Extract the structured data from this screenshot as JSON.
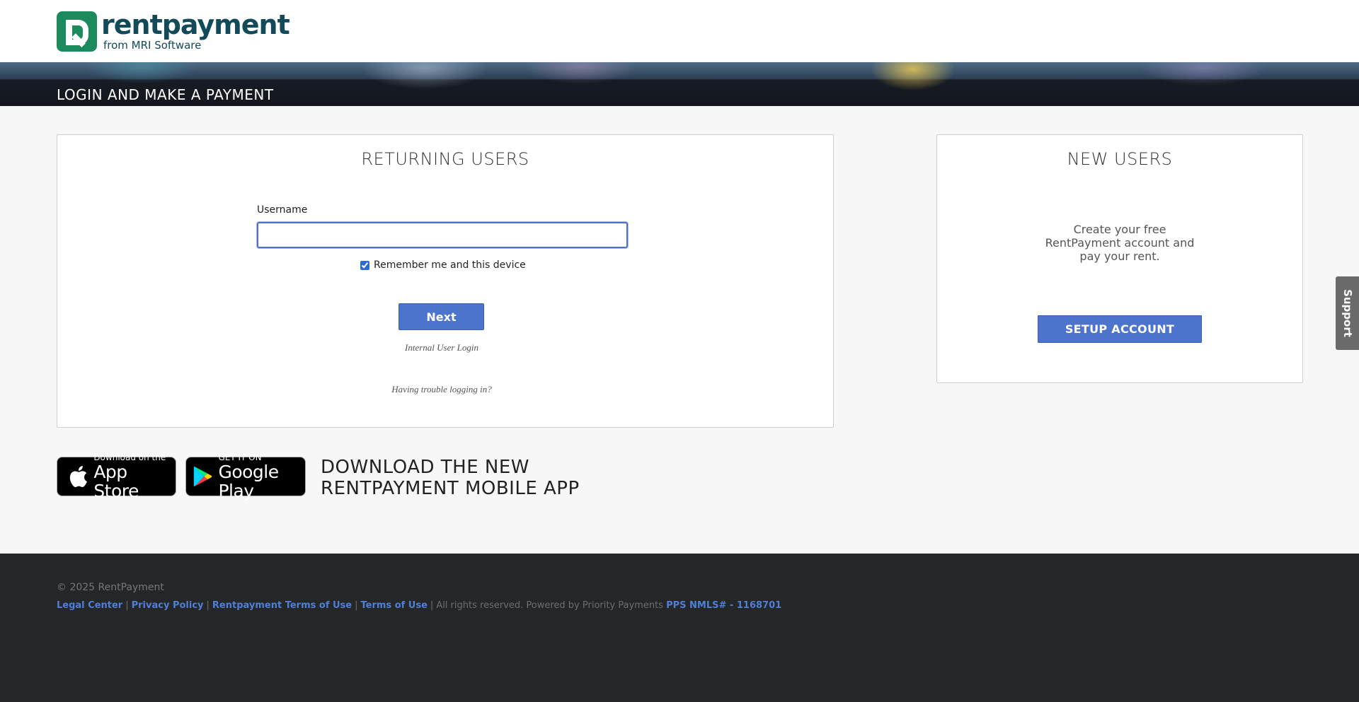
{
  "brand": {
    "name": "rentpayment",
    "subtitle": "from MRI Software",
    "color": "#1c8a5c",
    "text_color": "#134a5a"
  },
  "banner": {
    "title": "LOGIN AND MAKE A PAYMENT"
  },
  "returning": {
    "title": "RETURNING USERS",
    "username_label": "Username",
    "username_value": "",
    "remember_label": "Remember me and this device",
    "remember_checked": true,
    "next_label": "Next",
    "internal_login": "Internal User Login",
    "trouble": "Having trouble logging in?"
  },
  "new_users": {
    "title": "NEW USERS",
    "desc_line1": "Create your free",
    "desc_line2": "RentPayment account and",
    "desc_line3": "pay your rent.",
    "setup_label": "SETUP ACCOUNT"
  },
  "apps": {
    "apple_small": "Download on the",
    "apple_big": "App Store",
    "google_small": "GET IT ON",
    "google_big": "Google Play",
    "headline_line1": "DOWNLOAD THE NEW",
    "headline_line2": "RENTPAYMENT MOBILE APP"
  },
  "footer": {
    "copyright": "© 2025 RentPayment",
    "legal_center": "Legal Center",
    "privacy_policy": "Privacy Policy",
    "rentpayment_terms": "Rentpayment Terms of Use",
    "terms_of_use": "Terms of Use",
    "rights_text": "All rights reserved. Powered by Priority Payments",
    "nmls": "PPS NMLS# - 1168701"
  },
  "support": {
    "label": "Support"
  },
  "colors": {
    "button_blue": "#4c74cc",
    "footer_bg": "#242628",
    "link_blue": "#4f7fd6"
  }
}
